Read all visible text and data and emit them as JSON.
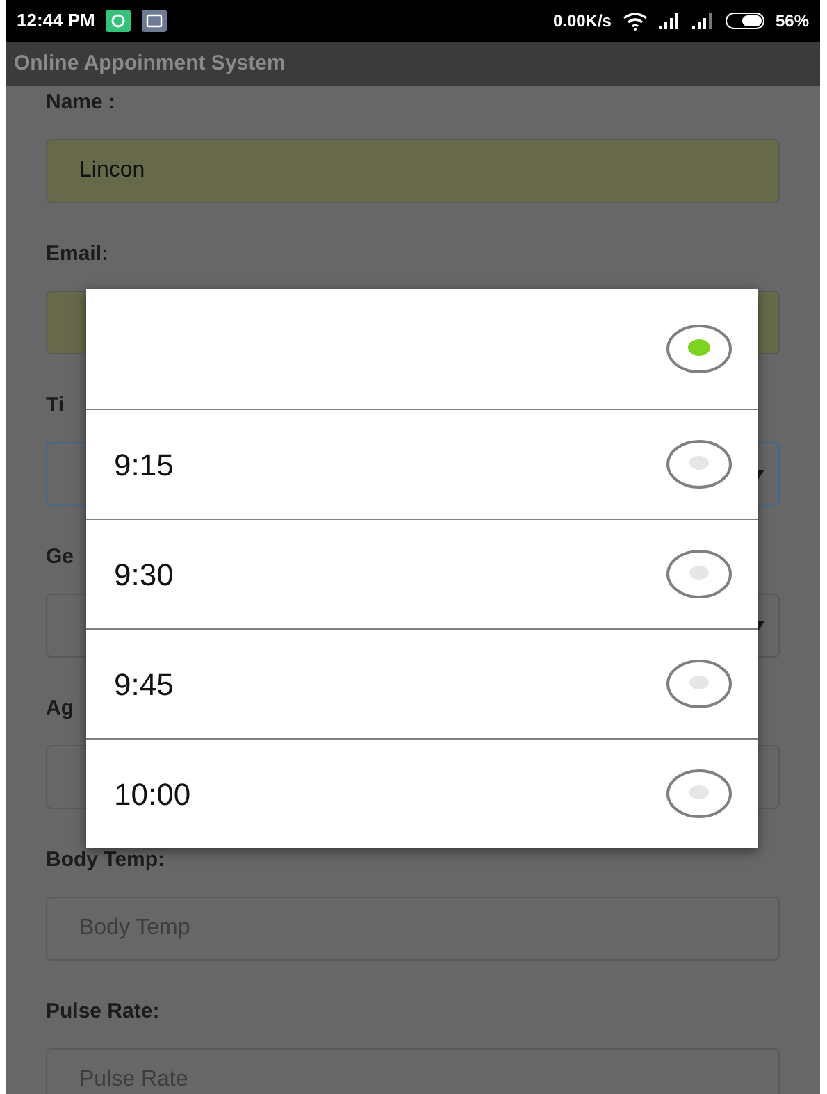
{
  "status_bar": {
    "time": "12:44 PM",
    "speed": "0.00K/s",
    "battery": "56%"
  },
  "app_bar": {
    "title": "Online Appoinment System"
  },
  "form": {
    "fields": [
      {
        "label": "Name :",
        "kind": "text",
        "filled": true,
        "focused": false,
        "value": "Lincon"
      },
      {
        "label": "Email:",
        "kind": "text",
        "filled": true,
        "focused": false
      },
      {
        "label": "Ti",
        "kind": "select",
        "filled": false,
        "focused": true
      },
      {
        "label": "Ge",
        "kind": "select",
        "filled": false,
        "focused": false
      },
      {
        "label": "Ag",
        "kind": "text",
        "filled": false,
        "focused": false
      },
      {
        "label": "Body Temp:",
        "kind": "text",
        "filled": false,
        "focused": false,
        "placeholder": "Body Temp"
      },
      {
        "label": "Pulse Rate:",
        "kind": "text",
        "filled": false,
        "focused": false,
        "placeholder": "Pulse Rate"
      }
    ]
  },
  "dialog": {
    "options": [
      {
        "selected": true
      },
      {
        "label": "9:15",
        "selected": false
      },
      {
        "label": "9:30",
        "selected": false
      },
      {
        "label": "9:45",
        "selected": false
      },
      {
        "label": "10:00",
        "selected": false
      }
    ]
  }
}
